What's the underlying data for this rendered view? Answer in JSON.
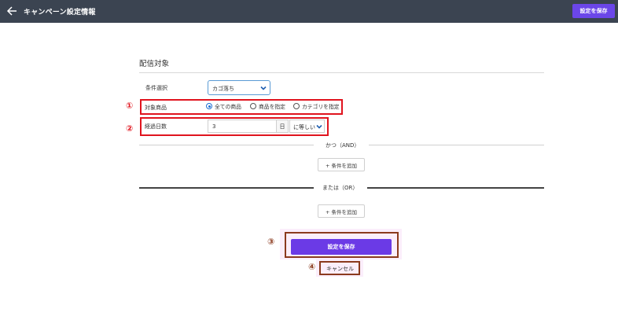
{
  "header": {
    "title": "キャンペーン設定情報",
    "save_label": "設定を保存",
    "background": "#3b4451",
    "accent": "#6b46e9"
  },
  "section": {
    "title": "配信対象"
  },
  "condition": {
    "label": "条件選択",
    "value": "カゴ落ち"
  },
  "target_product": {
    "label": "対象商品",
    "options": [
      "全ての商品",
      "商品を指定",
      "カテゴリを指定"
    ],
    "selected": "全ての商品"
  },
  "elapsed_days": {
    "label": "経過日数",
    "value": "3",
    "unit": "日",
    "comparison": "に等しい"
  },
  "and_group": {
    "divider": "かつ（AND）",
    "add_label": "+ 条件を追加"
  },
  "or_group": {
    "divider": "または（OR）",
    "add_label": "+ 条件を追加"
  },
  "footer": {
    "save_label": "設定を保存",
    "cancel_label": "キャンセル"
  },
  "annotations": {
    "n1": "①",
    "n2": "②",
    "n3": "③",
    "n4": "④",
    "red": "#e0141e",
    "brown": "#8b3a1e"
  }
}
